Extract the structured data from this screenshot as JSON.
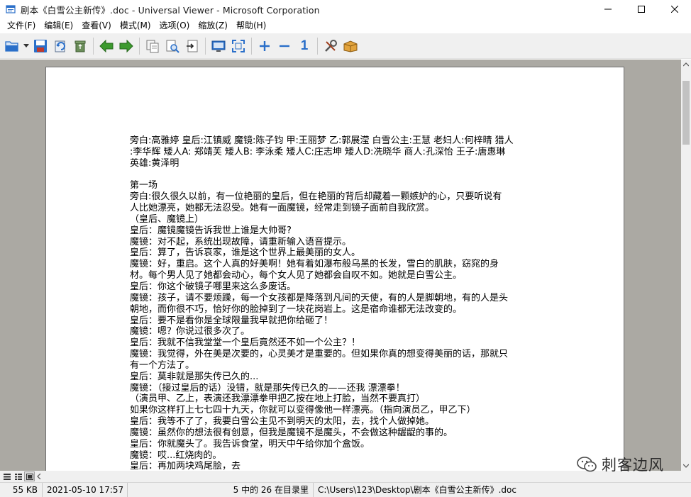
{
  "window": {
    "title": "剧本《白雪公主新传》.doc - Universal Viewer - Microsoft Corporation"
  },
  "menu": [
    "文件(F)",
    "编辑(E)",
    "查看(V)",
    "模式(M)",
    "选项(O)",
    "缩放(Z)",
    "帮助(H)"
  ],
  "toolbar": {
    "zoom_reset_label": "1"
  },
  "document": {
    "lines": [
      "旁白:高雅婷 皇后:江镇威 魔镜:陈子钧 甲:王丽梦 乙:郭展滢 白雪公主:王慧 老妇人:何梓晴 猎人",
      ":李华辉 矮人A: 郑靖芙 矮人B: 李泳柔 矮人C:庄志坤 矮人D:冼晓华 商人:孔深怡 王子:唐惠琳",
      "英雄:黄泽明",
      "",
      "第一场",
      "旁白:很久很久以前，有一位艳丽的皇后，但在艳丽的背后却藏着一颗嫉妒的心，只要听说有",
      "人比她漂亮，她都无法忍受。她有一面魔镜，经常走到镜子面前自我欣赏。",
      "（皇后、魔镜上）",
      "皇后：魔镜魔镜告诉我世上谁是大帅哥?",
      "魔镜：对不起，系统出现故障，请重新输入语音提示。",
      "皇后：算了，告诉哀家，谁是这个世界上最美丽的女人。",
      "魔镜：好，重启。这个人真的好美啊！她有着如瀑布般乌黑的长发，雪白的肌肤，窈窕的身",
      "材。每个男人见了她都会动心，每个女人见了她都会自叹不如。她就是白雪公主。",
      "皇后：你这个破镜子哪里来这么多废话。",
      "魔镜：孩子，请不要烦躁，每一个女孩都是降落到凡间的天使，有的人是脚朝地，有的人是头",
      "朝地，而你很不巧，恰好你的脸掉到了一块花岗岩上。这是宿命谁都无法改变的。",
      "皇后：要不是看你是全球限量我早就把你给砸了！",
      "魔镜：嗯？你说过很多次了。",
      "皇后：我就不信我堂堂一个皇后竟然还不如一个公主？！",
      "魔镜：我觉得，外在美是次要的，心灵美才是重要的。但如果你真的想变得美丽的话，那就只",
      "有一个方法了。",
      "皇后：莫非就是那失传已久的...",
      "魔镜：（接过皇后的话）没错，就是那失传已久的——还我 漂漂拳！",
      "（演员甲、乙上，表演还我漂漂拳甲把乙按在地上打脸，当然不要真打）",
      "如果你这样打上七七四十九天，你就可以变得像他一样漂亮。（指向演员乙，甲乙下）",
      "皇后：我等不了了，我要白雪公主见不到明天的太阳，去，找个人做掉她。",
      "魔镜：虽然你的想法很有创意，但我是魔镜不是魔头，不会做这种龌龊的事的。",
      "皇后：你就魔头了。我告诉食堂，明天中午给你加个盒饭。",
      "魔镜：哎...红烧肉的。",
      "皇后：再加两块鸡尾脍，去"
    ]
  },
  "watermark": {
    "text": "刺客边风"
  },
  "status": {
    "size": "55 KB",
    "datetime": "2021-05-10 17:57",
    "position": "5 中的 26 在目录里",
    "path": "C:\\Users\\123\\Desktop\\剧本《白雪公主新传》.doc"
  },
  "colors": {
    "viewer_background": "#aba9a3",
    "toolbar_background": "#f0f0f0",
    "accent_blue": "#2a6fc9",
    "arrow_green": "#3c9a2e"
  }
}
